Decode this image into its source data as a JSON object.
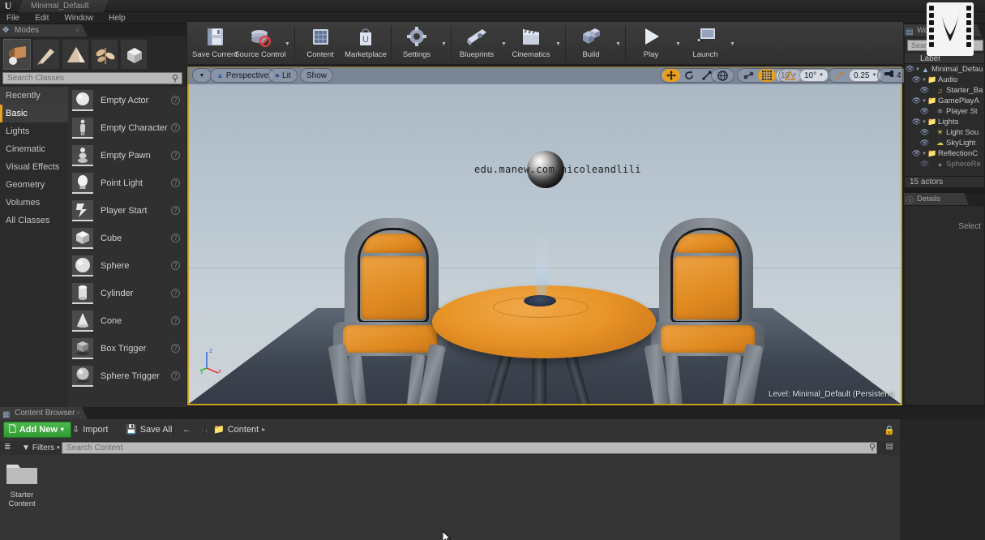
{
  "window": {
    "title": "Minimal_Default",
    "logo_icon": "unreal-engine-logo"
  },
  "menu": {
    "items": [
      {
        "label": "File"
      },
      {
        "label": "Edit"
      },
      {
        "label": "Window"
      },
      {
        "label": "Help"
      }
    ]
  },
  "modes_panel": {
    "tab_label": "Modes",
    "tab_icon": "modes-icon",
    "close_icon": "×",
    "mode_buttons": [
      {
        "name": "place-mode",
        "icon": "place-icon",
        "active": true
      },
      {
        "name": "paint-mode",
        "icon": "paint-brush-icon",
        "active": false
      },
      {
        "name": "landscape-mode",
        "icon": "landscape-icon",
        "active": false
      },
      {
        "name": "foliage-mode",
        "icon": "foliage-leaf-icon",
        "active": false
      },
      {
        "name": "geometry-editing-mode",
        "icon": "geometry-box-icon",
        "active": false
      }
    ],
    "search": {
      "placeholder": "Search Classes",
      "value": "",
      "icon": "search-icon"
    },
    "categories": [
      {
        "label": "Recently Placed",
        "active": false,
        "highlighted": true
      },
      {
        "label": "Basic",
        "active": true,
        "highlighted": false
      },
      {
        "label": "Lights",
        "active": false,
        "highlighted": false
      },
      {
        "label": "Cinematic",
        "active": false,
        "highlighted": false
      },
      {
        "label": "Visual Effects",
        "active": false,
        "highlighted": false
      },
      {
        "label": "Geometry",
        "active": false,
        "highlighted": false
      },
      {
        "label": "Volumes",
        "active": false,
        "highlighted": false
      },
      {
        "label": "All Classes",
        "active": false,
        "highlighted": false
      }
    ],
    "classes": [
      {
        "label": "Empty Actor",
        "thumb": "sphere-actor-thumb",
        "help_icon": "?"
      },
      {
        "label": "Empty Character",
        "thumb": "character-thumb",
        "help_icon": "?"
      },
      {
        "label": "Empty Pawn",
        "thumb": "pawn-thumb",
        "help_icon": "?"
      },
      {
        "label": "Point Light",
        "thumb": "point-light-thumb",
        "help_icon": "?"
      },
      {
        "label": "Player Start",
        "thumb": "player-start-thumb",
        "help_icon": "?"
      },
      {
        "label": "Cube",
        "thumb": "cube-thumb",
        "help_icon": "?"
      },
      {
        "label": "Sphere",
        "thumb": "sphere-thumb",
        "help_icon": "?"
      },
      {
        "label": "Cylinder",
        "thumb": "cylinder-thumb",
        "help_icon": "?"
      },
      {
        "label": "Cone",
        "thumb": "cone-thumb",
        "help_icon": "?"
      },
      {
        "label": "Box Trigger",
        "thumb": "box-trigger-thumb",
        "help_icon": "?"
      },
      {
        "label": "Sphere Trigger",
        "thumb": "sphere-trigger-thumb",
        "help_icon": "?"
      }
    ]
  },
  "main_toolbar": {
    "items": [
      {
        "label": "Save Current",
        "icon": "floppy-disk-icon",
        "caret": false
      },
      {
        "label": "Source Control",
        "icon": "source-control-icon",
        "caret": true
      },
      {
        "label": "Content",
        "icon": "content-grid-icon",
        "caret": false
      },
      {
        "label": "Marketplace",
        "icon": "marketplace-bag-icon",
        "caret": false
      },
      {
        "label": "Settings",
        "icon": "settings-gear-icon",
        "caret": true
      },
      {
        "label": "Blueprints",
        "icon": "blueprint-icon",
        "caret": true
      },
      {
        "label": "Cinematics",
        "icon": "clapperboard-icon",
        "caret": true
      },
      {
        "label": "Build",
        "icon": "build-cubes-icon",
        "caret": true
      },
      {
        "label": "Play",
        "icon": "play-triangle-icon",
        "caret": true
      },
      {
        "label": "Launch",
        "icon": "launch-device-icon",
        "caret": true
      }
    ]
  },
  "viewport": {
    "menu_caret_icon": "chevron-down-icon",
    "perspective_label": "Perspective",
    "perspective_icon": "camera-icon",
    "lit_label": "Lit",
    "lit_icon": "lit-sphere-icon",
    "show_label": "Show",
    "transform_tools": [
      {
        "name": "translate-tool",
        "icon": "move-arrows-icon",
        "active": true
      },
      {
        "name": "rotate-tool",
        "icon": "rotate-icon",
        "active": false
      },
      {
        "name": "scale-tool",
        "icon": "scale-icon",
        "active": false
      }
    ],
    "coordinate_system": {
      "name": "world-coordinate-toggle",
      "icon": "globe-icon"
    },
    "surface_snap": {
      "name": "surface-snap-toggle",
      "icon": "surface-snap-icon",
      "active": false
    },
    "grid_snap": {
      "name": "grid-snap-toggle",
      "icon": "grid-icon",
      "active": true,
      "value": "10"
    },
    "angle_snap": {
      "name": "angle-snap-toggle",
      "icon": "angle-icon",
      "active": false,
      "value": "10°"
    },
    "scale_snap": {
      "name": "scale-snap-toggle",
      "icon": "scale-snap-icon",
      "active": false,
      "value": "0.25"
    },
    "camera_speed": {
      "name": "camera-speed",
      "icon": "camera-speed-icon",
      "value": "4"
    },
    "maximize_icon": "maximize-viewport-icon",
    "watermark": "edu.manew.com nicoleandlili",
    "level_status": "Level:  Minimal_Default (Persistent)",
    "axis_labels": {
      "z": "z",
      "x": "x",
      "y": "y"
    },
    "accent_color": "#e8a020",
    "border_color": "#c8a020"
  },
  "outliner": {
    "tab_label": "World Outliner",
    "tab_icon": "world-outliner-icon",
    "search": {
      "placeholder": "Search",
      "value": ""
    },
    "column_header": "Label",
    "rows": [
      {
        "label": "Minimal_Defau",
        "depth": 0,
        "icon": "level-icon",
        "expander": "▾",
        "eye": "eye-icon"
      },
      {
        "label": "Audio",
        "depth": 1,
        "icon": "folder-icon",
        "expander": "▾",
        "eye": "eye-icon"
      },
      {
        "label": "Starter_Ba",
        "depth": 2,
        "icon": "audio-icon",
        "expander": "",
        "eye": "eye-icon"
      },
      {
        "label": "GamePlayA",
        "depth": 1,
        "icon": "folder-icon",
        "expander": "▾",
        "eye": "eye-icon"
      },
      {
        "label": "Player St",
        "depth": 2,
        "icon": "player-start-icon",
        "expander": "",
        "eye": "eye-icon"
      },
      {
        "label": "Lights",
        "depth": 1,
        "icon": "folder-icon",
        "expander": "▾",
        "eye": "eye-icon"
      },
      {
        "label": "Light Sou",
        "depth": 2,
        "icon": "directional-light-icon",
        "expander": "",
        "eye": "eye-icon"
      },
      {
        "label": "SkyLight",
        "depth": 2,
        "icon": "sky-light-icon",
        "expander": "",
        "eye": "eye-icon"
      },
      {
        "label": "ReflectionC",
        "depth": 1,
        "icon": "folder-icon",
        "expander": "▾",
        "eye": "eye-icon"
      },
      {
        "label": "SphereRe",
        "depth": 2,
        "icon": "reflection-capture-icon",
        "expander": "",
        "eye": "eye-icon"
      }
    ],
    "actor_count": "15 actors"
  },
  "details": {
    "tab_label": "Details",
    "tab_icon": "details-icon",
    "empty_text": "Select"
  },
  "content_browser": {
    "tab_label": "Content Browser",
    "tab_icon": "content-browser-icon",
    "close_icon": "×",
    "add_new": {
      "label": "Add New",
      "icon": "add-new-icon",
      "caret": "▾"
    },
    "import": {
      "label": "Import",
      "icon": "import-icon"
    },
    "save_all": {
      "label": "Save All",
      "icon": "save-all-icon"
    },
    "back_icon": "arrow-left-icon",
    "forward_icon": "arrow-right-icon",
    "breadcrumb": {
      "label": "Content",
      "icon": "folder-icon",
      "caret": "▸"
    },
    "filters": {
      "label": "Filters",
      "icon": "filter-icon",
      "caret": "▾"
    },
    "search": {
      "placeholder": "Search Content",
      "value": "",
      "icon": "search-icon"
    },
    "assets": [
      {
        "label_line1": "Starter",
        "label_line2": "Content",
        "type": "folder"
      }
    ]
  },
  "cursor": {
    "name": "mouse-pointer"
  },
  "overlay": {
    "name": "film-strip-overlay"
  }
}
